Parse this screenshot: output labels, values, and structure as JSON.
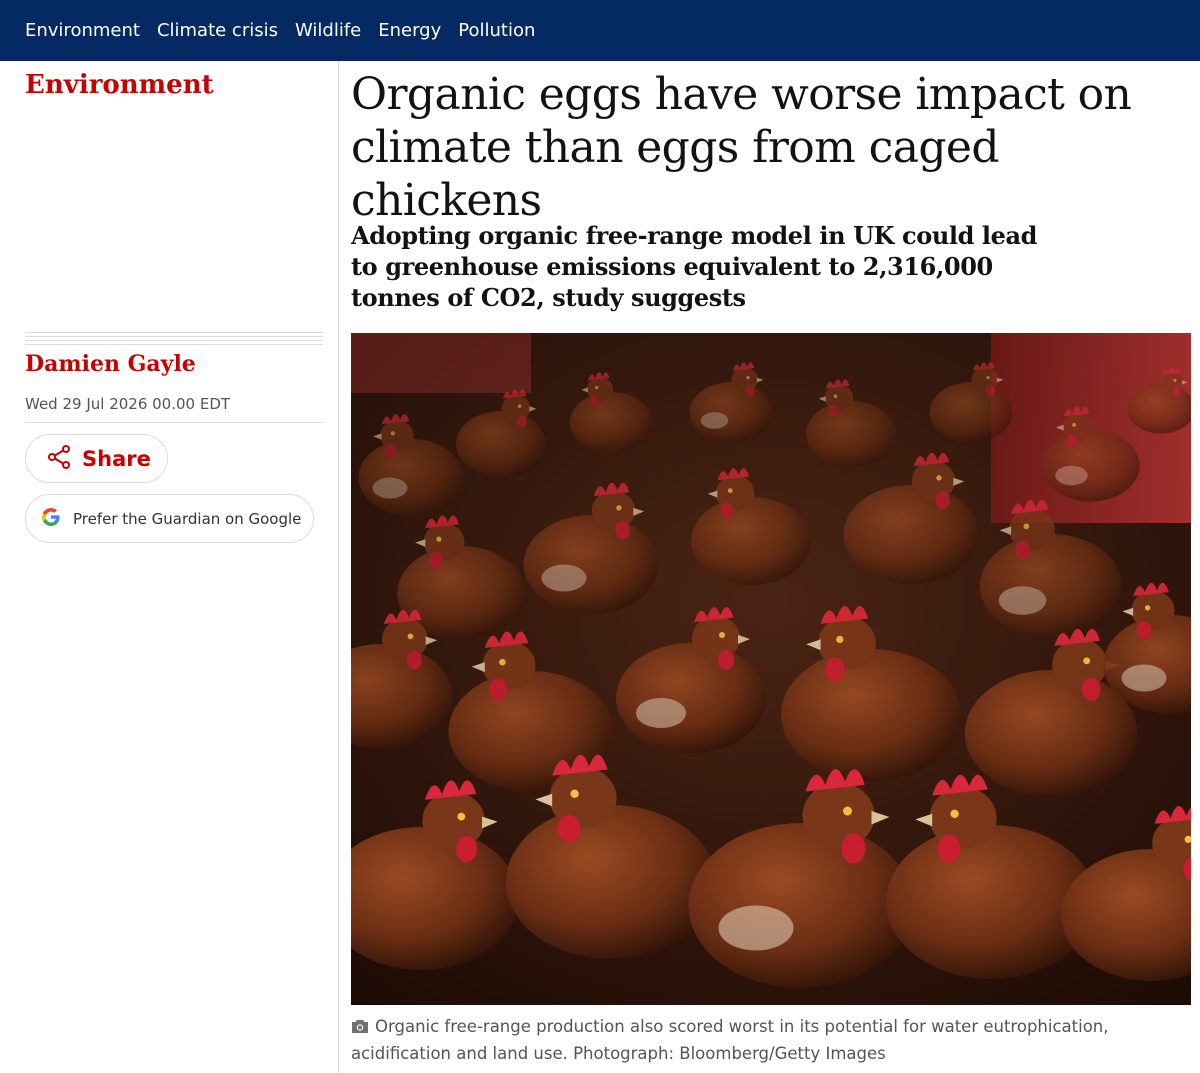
{
  "nav": {
    "items": [
      "Environment",
      "Climate crisis",
      "Wildlife",
      "Energy",
      "Pollution"
    ]
  },
  "article": {
    "section": "Environment",
    "headline": "Organic eggs have worse impact on climate than eggs from caged chickens",
    "standfirst": "Adopting organic free-range model in UK could lead to greenhouse emissions equivalent to 2,316,000 tonnes of CO2, study suggests",
    "byline": "Damien Gayle",
    "date": "Wed 29 Jul 2026 00.00 EDT",
    "share_label": "Share",
    "google_label": "Prefer the Guardian on Google",
    "image_alt": "Photograph of many brown hens with red combs crowded together indoors",
    "caption": "Organic free-range production also scored worst in its potential for water eutrophication, acidification and land use. Photograph: Bloomberg/Getty Images"
  },
  "colors": {
    "nav_bg": "#052962",
    "accent_red": "#c70000",
    "text": "#121212",
    "muted": "#545454"
  },
  "icons": [
    "share-icon",
    "google-g-icon",
    "camera-icon"
  ]
}
